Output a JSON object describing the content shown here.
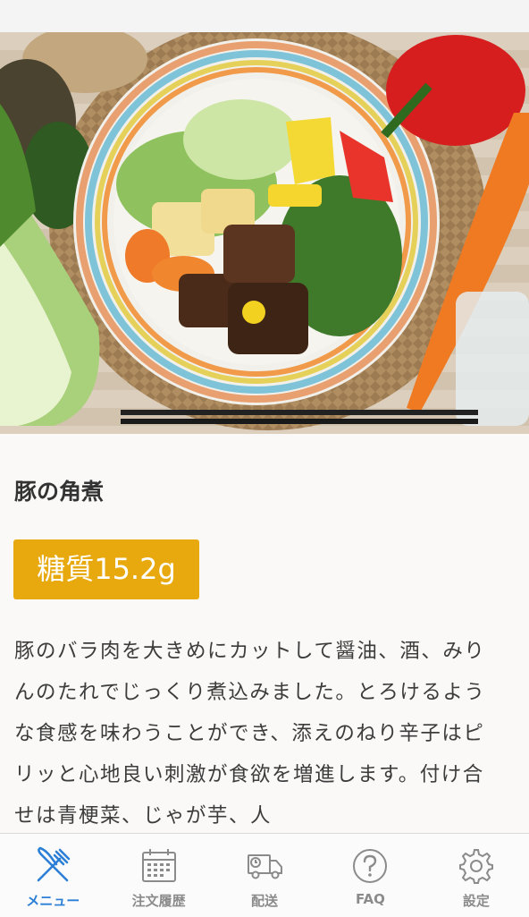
{
  "menu_item": {
    "image_alt": "豚の角煮",
    "title": "豚の角煮",
    "carb_label": "糖質15.2g",
    "description": "豚のバラ肉を大きめにカットして醤油、酒、みりんのたれでじっくり煮込みました。とろけるような食感を味わうことができ、添えのねり辛子はピリッと心地良い刺激が食欲を増進します。付け合せは青梗菜、じゃが芋、人"
  },
  "colors": {
    "accent": "#2b7fd6",
    "badge": "#e8a90f",
    "inactive": "#8b8b8b"
  },
  "tabs": [
    {
      "label": "メニュー",
      "icon": "fork-knife-icon",
      "active": true
    },
    {
      "label": "注文履歴",
      "icon": "calendar-icon",
      "active": false
    },
    {
      "label": "配送",
      "icon": "delivery-truck-icon",
      "active": false
    },
    {
      "label": "FAQ",
      "icon": "question-circle-icon",
      "active": false
    },
    {
      "label": "設定",
      "icon": "gear-icon",
      "active": false
    }
  ]
}
